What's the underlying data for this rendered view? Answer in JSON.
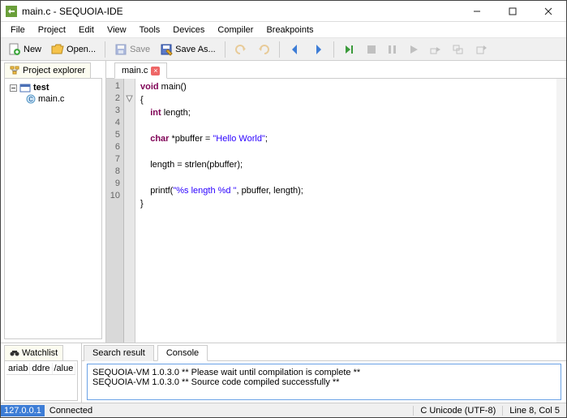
{
  "window": {
    "title": "main.c - SEQUOIA-IDE"
  },
  "menu": [
    "File",
    "Project",
    "Edit",
    "View",
    "Tools",
    "Devices",
    "Compiler",
    "Breakpoints"
  ],
  "toolbar": {
    "new": "New",
    "open": "Open...",
    "save": "Save",
    "save_as": "Save As..."
  },
  "sidebar": {
    "title": "Project explorer",
    "project_name": "test",
    "file_name": "main.c"
  },
  "editor": {
    "tab": "main.c",
    "line_numbers": [
      "1",
      "2",
      "3",
      "4",
      "5",
      "6",
      "7",
      "8",
      "9",
      "10"
    ],
    "code": {
      "l1": {
        "a": "void",
        "b": " main()"
      },
      "l2": "{",
      "l3": {
        "a": "    int",
        "b": " length;"
      },
      "l4": "",
      "l5": {
        "a": "    char",
        "b": " *pbuffer = ",
        "c": "\"Hello World\"",
        "d": ";"
      },
      "l6": "",
      "l7": "    length = strlen(pbuffer);",
      "l8": "",
      "l9": {
        "a": "    printf(",
        "b": "\"%s length %d \"",
        "c": ", pbuffer, length);"
      },
      "l10": "}"
    }
  },
  "watch": {
    "title": "Watchlist",
    "cols": [
      "ariab",
      "ddre",
      "/alue"
    ]
  },
  "bottom_tabs": {
    "search": "Search result",
    "console": "Console"
  },
  "console": {
    "line1": "SEQUOIA-VM 1.0.3.0 ** Please wait until compilation is complete **",
    "line2": "SEQUOIA-VM 1.0.3.0 ** Source code compiled successfully **"
  },
  "status": {
    "ip": "127.0.0.1",
    "conn": "Connected",
    "encoding": "C  Unicode (UTF-8)",
    "pos": "Line 8, Col 5"
  }
}
